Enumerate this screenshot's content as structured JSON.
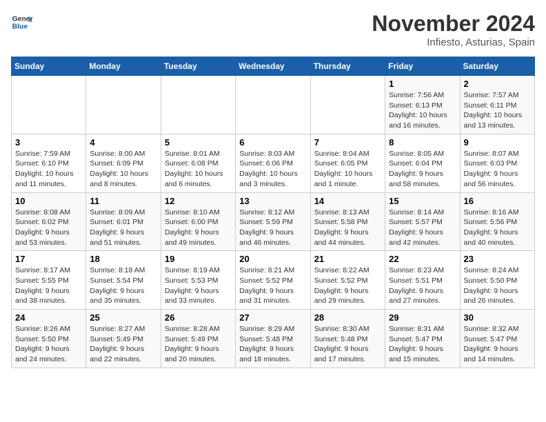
{
  "logo": {
    "line1": "General",
    "line2": "Blue"
  },
  "title": "November 2024",
  "location": "Infiesto, Asturias, Spain",
  "weekdays": [
    "Sunday",
    "Monday",
    "Tuesday",
    "Wednesday",
    "Thursday",
    "Friday",
    "Saturday"
  ],
  "weeks": [
    [
      {
        "num": "",
        "info": ""
      },
      {
        "num": "",
        "info": ""
      },
      {
        "num": "",
        "info": ""
      },
      {
        "num": "",
        "info": ""
      },
      {
        "num": "",
        "info": ""
      },
      {
        "num": "1",
        "info": "Sunrise: 7:56 AM\nSunset: 6:13 PM\nDaylight: 10 hours and 16 minutes."
      },
      {
        "num": "2",
        "info": "Sunrise: 7:57 AM\nSunset: 6:11 PM\nDaylight: 10 hours and 13 minutes."
      }
    ],
    [
      {
        "num": "3",
        "info": "Sunrise: 7:59 AM\nSunset: 6:10 PM\nDaylight: 10 hours and 11 minutes."
      },
      {
        "num": "4",
        "info": "Sunrise: 8:00 AM\nSunset: 6:09 PM\nDaylight: 10 hours and 8 minutes."
      },
      {
        "num": "5",
        "info": "Sunrise: 8:01 AM\nSunset: 6:08 PM\nDaylight: 10 hours and 6 minutes."
      },
      {
        "num": "6",
        "info": "Sunrise: 8:03 AM\nSunset: 6:06 PM\nDaylight: 10 hours and 3 minutes."
      },
      {
        "num": "7",
        "info": "Sunrise: 8:04 AM\nSunset: 6:05 PM\nDaylight: 10 hours and 1 minute."
      },
      {
        "num": "8",
        "info": "Sunrise: 8:05 AM\nSunset: 6:04 PM\nDaylight: 9 hours and 58 minutes."
      },
      {
        "num": "9",
        "info": "Sunrise: 8:07 AM\nSunset: 6:03 PM\nDaylight: 9 hours and 56 minutes."
      }
    ],
    [
      {
        "num": "10",
        "info": "Sunrise: 8:08 AM\nSunset: 6:02 PM\nDaylight: 9 hours and 53 minutes."
      },
      {
        "num": "11",
        "info": "Sunrise: 8:09 AM\nSunset: 6:01 PM\nDaylight: 9 hours and 51 minutes."
      },
      {
        "num": "12",
        "info": "Sunrise: 8:10 AM\nSunset: 6:00 PM\nDaylight: 9 hours and 49 minutes."
      },
      {
        "num": "13",
        "info": "Sunrise: 8:12 AM\nSunset: 5:59 PM\nDaylight: 9 hours and 46 minutes."
      },
      {
        "num": "14",
        "info": "Sunrise: 8:13 AM\nSunset: 5:58 PM\nDaylight: 9 hours and 44 minutes."
      },
      {
        "num": "15",
        "info": "Sunrise: 8:14 AM\nSunset: 5:57 PM\nDaylight: 9 hours and 42 minutes."
      },
      {
        "num": "16",
        "info": "Sunrise: 8:16 AM\nSunset: 5:56 PM\nDaylight: 9 hours and 40 minutes."
      }
    ],
    [
      {
        "num": "17",
        "info": "Sunrise: 8:17 AM\nSunset: 5:55 PM\nDaylight: 9 hours and 38 minutes."
      },
      {
        "num": "18",
        "info": "Sunrise: 8:18 AM\nSunset: 5:54 PM\nDaylight: 9 hours and 35 minutes."
      },
      {
        "num": "19",
        "info": "Sunrise: 8:19 AM\nSunset: 5:53 PM\nDaylight: 9 hours and 33 minutes."
      },
      {
        "num": "20",
        "info": "Sunrise: 8:21 AM\nSunset: 5:52 PM\nDaylight: 9 hours and 31 minutes."
      },
      {
        "num": "21",
        "info": "Sunrise: 8:22 AM\nSunset: 5:52 PM\nDaylight: 9 hours and 29 minutes."
      },
      {
        "num": "22",
        "info": "Sunrise: 8:23 AM\nSunset: 5:51 PM\nDaylight: 9 hours and 27 minutes."
      },
      {
        "num": "23",
        "info": "Sunrise: 8:24 AM\nSunset: 5:50 PM\nDaylight: 9 hours and 26 minutes."
      }
    ],
    [
      {
        "num": "24",
        "info": "Sunrise: 8:26 AM\nSunset: 5:50 PM\nDaylight: 9 hours and 24 minutes."
      },
      {
        "num": "25",
        "info": "Sunrise: 8:27 AM\nSunset: 5:49 PM\nDaylight: 9 hours and 22 minutes."
      },
      {
        "num": "26",
        "info": "Sunrise: 8:28 AM\nSunset: 5:49 PM\nDaylight: 9 hours and 20 minutes."
      },
      {
        "num": "27",
        "info": "Sunrise: 8:29 AM\nSunset: 5:48 PM\nDaylight: 9 hours and 18 minutes."
      },
      {
        "num": "28",
        "info": "Sunrise: 8:30 AM\nSunset: 5:48 PM\nDaylight: 9 hours and 17 minutes."
      },
      {
        "num": "29",
        "info": "Sunrise: 8:31 AM\nSunset: 5:47 PM\nDaylight: 9 hours and 15 minutes."
      },
      {
        "num": "30",
        "info": "Sunrise: 8:32 AM\nSunset: 5:47 PM\nDaylight: 9 hours and 14 minutes."
      }
    ]
  ]
}
